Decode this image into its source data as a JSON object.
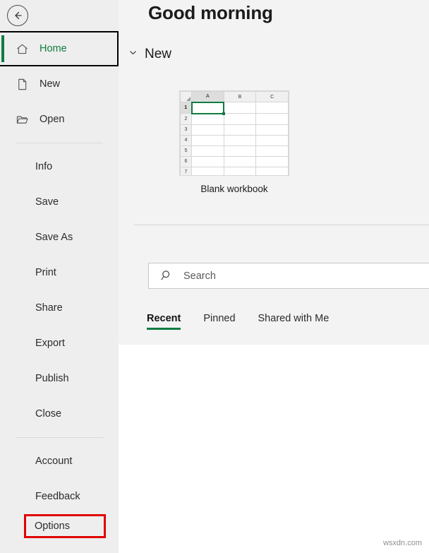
{
  "colors": {
    "accent_green": "#107c41",
    "callout_red": "#e00000",
    "sidebar_bg": "#eeeeee",
    "main_bg": "#f3f3f3",
    "surface_white": "#ffffff"
  },
  "sidebar": {
    "back_button": {
      "icon": "back-arrow-icon",
      "label": "Back"
    },
    "items": [
      {
        "label": "Home",
        "icon": "home-icon",
        "selected": true,
        "has_icon": true
      },
      {
        "label": "New",
        "icon": "document-icon",
        "selected": false,
        "has_icon": true
      },
      {
        "label": "Open",
        "icon": "folder-icon",
        "selected": false,
        "has_icon": true
      }
    ],
    "group2": [
      {
        "label": "Info"
      },
      {
        "label": "Save"
      },
      {
        "label": "Save As"
      },
      {
        "label": "Print"
      },
      {
        "label": "Share"
      },
      {
        "label": "Export"
      },
      {
        "label": "Publish"
      },
      {
        "label": "Close"
      }
    ],
    "group3": [
      {
        "label": "Account"
      },
      {
        "label": "Feedback"
      },
      {
        "label": "Options",
        "highlighted": true
      }
    ]
  },
  "main": {
    "greeting": "Good morning",
    "new_section": {
      "title": "New",
      "chevron": "chevron-down-icon",
      "templates": [
        {
          "name": "Blank workbook",
          "columns": [
            "A",
            "B",
            "C"
          ],
          "rows": [
            "1",
            "2",
            "3",
            "4",
            "5",
            "6",
            "7"
          ],
          "active_cell": "A1"
        }
      ]
    },
    "search": {
      "placeholder": "Search",
      "value": "",
      "icon": "search-icon"
    },
    "tabs": [
      {
        "label": "Recent",
        "active": true
      },
      {
        "label": "Pinned",
        "active": false
      },
      {
        "label": "Shared with Me",
        "active": false
      }
    ]
  },
  "watermark": "wsxdn.com"
}
